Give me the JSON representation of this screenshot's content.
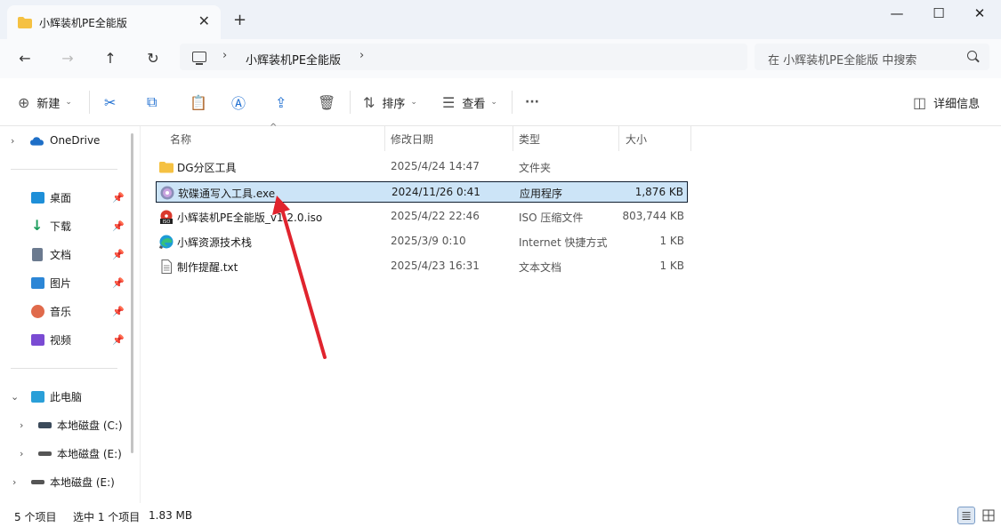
{
  "window": {
    "tab_title": "小辉装机PE全能版",
    "close_tab_glyph": "✕",
    "new_tab_glyph": "+",
    "minimize_glyph": "—",
    "maximize_glyph": "☐",
    "close_glyph": "✕"
  },
  "address": {
    "back_glyph": "←",
    "forward_glyph": "→",
    "up_glyph": "↑",
    "refresh_glyph": "↻",
    "separator": "›",
    "crumb": "小辉装机PE全能版",
    "search_placeholder": "在 小辉装机PE全能版 中搜索"
  },
  "toolbar": {
    "new_icon": "⊕",
    "new_label": "新建",
    "caret": "⌄",
    "cut_icon": "✂",
    "copy_icon": "⧉",
    "paste_icon": "📋",
    "rename_icon": "Ⓐ",
    "share_icon": "⇪",
    "delete_icon": "🗑",
    "sort_icon": "⇅",
    "sort_label": "排序",
    "view_icon": "☰",
    "view_label": "查看",
    "more_icon": "···",
    "details_icon": "◫",
    "details_label": "详细信息"
  },
  "sidebar": {
    "chevron_right": "›",
    "chevron_down": "⌄",
    "pin": "📌",
    "onedrive": "OneDrive",
    "quick_access": [
      {
        "label": "桌面",
        "color": "#1e8fd8"
      },
      {
        "label": "下载",
        "color": "#1a9c5b"
      },
      {
        "label": "文档",
        "color": "#6b7a8f"
      },
      {
        "label": "图片",
        "color": "#2c86d6"
      },
      {
        "label": "音乐",
        "color": "#e06a4b"
      },
      {
        "label": "视频",
        "color": "#7a4bd3"
      }
    ],
    "this_pc": "此电脑",
    "drives": [
      "本地磁盘 (C:)",
      "本地磁盘 (E:)",
      "本地磁盘 (E:)"
    ]
  },
  "columns": {
    "name": "名称",
    "sort_glyph": "^",
    "modified": "修改日期",
    "type": "类型",
    "size": "大小"
  },
  "files": [
    {
      "name": "DG分区工具",
      "modified": "2025/4/24 14:47",
      "type": "文件夹",
      "size": "",
      "icon": "folder-icon",
      "selected": false
    },
    {
      "name": "软碟通写入工具.exe",
      "modified": "2024/11/26 0:41",
      "type": "应用程序",
      "size": "1,876 KB",
      "icon": "disc-app-icon",
      "selected": true
    },
    {
      "name": "小辉装机PE全能版_v1.2.0.iso",
      "modified": "2025/4/22 22:46",
      "type": "ISO 压缩文件",
      "size": "803,744 KB",
      "icon": "iso-icon",
      "selected": false
    },
    {
      "name": "小辉资源技术栈",
      "modified": "2025/3/9 0:10",
      "type": "Internet 快捷方式",
      "size": "1 KB",
      "icon": "edge-icon",
      "selected": false
    },
    {
      "name": "制作提醒.txt",
      "modified": "2025/4/23 16:31",
      "type": "文本文档",
      "size": "1 KB",
      "icon": "text-file-icon",
      "selected": false
    }
  ],
  "status": {
    "item_count": "5 个项目",
    "selection": "选中 1 个项目",
    "selected_size": "1.83 MB"
  },
  "colors": {
    "accent": "#1f6fd1",
    "selection": "#cce4f7",
    "annotation_arrow": "#e0242e",
    "folder": "#f5c142"
  }
}
